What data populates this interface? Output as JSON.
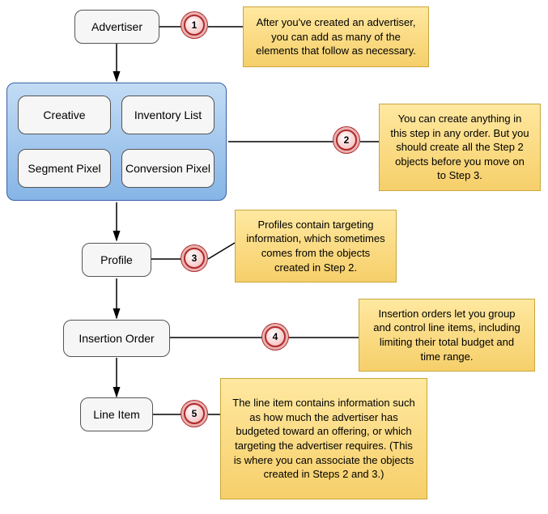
{
  "nodes": {
    "advertiser": "Advertiser",
    "profile": "Profile",
    "insertion_order": "Insertion Order",
    "line_item": "Line Item",
    "creative": "Creative",
    "inventory_list": "Inventory List",
    "segment_pixel": "Segment Pixel",
    "conversion_pixel": "Conversion Pixel"
  },
  "steps": {
    "s1": {
      "num": "1",
      "note": "After you've created an advertiser, you can add as many of the elements that follow as necessary."
    },
    "s2": {
      "num": "2",
      "note": "You can create anything in this step in any order. But you should create all the Step 2 objects before you move on to Step 3."
    },
    "s3": {
      "num": "3",
      "note": "Profiles contain targeting information, which sometimes comes from the objects created in Step 2."
    },
    "s4": {
      "num": "4",
      "note": "Insertion orders let you group and control line items, including limiting their total budget and time range."
    },
    "s5": {
      "num": "5",
      "note": "The line item contains information such as how much the advertiser has budgeted toward an offering, or which targeting the advertiser requires. (This is where you can associate the objects created in Steps 2 and 3.)"
    }
  }
}
